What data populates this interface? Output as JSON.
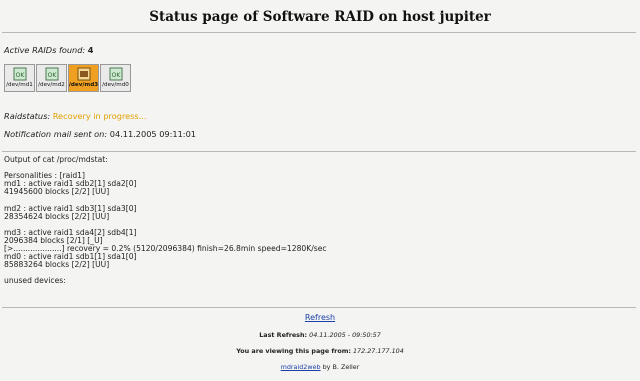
{
  "title": "Status page of Software RAID on host jupiter",
  "active_raids": {
    "label": "Active RAIDs found:",
    "value": "4"
  },
  "drives": [
    {
      "label": "/dev/md1",
      "icon": "disk-ok-icon",
      "active": false
    },
    {
      "label": "/dev/md2",
      "icon": "disk-ok-icon",
      "active": false
    },
    {
      "label": "/dev/md3",
      "icon": "disk-recovery-icon",
      "active": true
    },
    {
      "label": "/dev/md0",
      "icon": "disk-ok-icon",
      "active": false
    }
  ],
  "raid_status": {
    "label": "Raidstatus:",
    "value": "Recovery in progress..."
  },
  "notification": {
    "label": "Notification mail sent on:",
    "value": "04.11.2005 09:11:01"
  },
  "mdstat": {
    "heading": "Output of cat /proc/mdstat:",
    "lines": [
      "Personalities : [raid1]",
      "md1 : active raid1 sdb2[1] sda2[0]",
      "41945600 blocks [2/2] [UU]",
      "",
      "md2 : active raid1 sdb3[1] sda3[0]",
      "28354624 blocks [2/2] [UU]",
      "",
      "md3 : active raid1 sda4[2] sdb4[1]",
      "2096384 blocks [2/1] [_U]",
      "[>....................] recovery = 0.2% (5120/2096384) finish=26.8min speed=1280K/sec",
      "md0 : active raid1 sdb1[1] sda1[0]",
      "85883264 blocks [2/2] [UU]",
      "",
      "unused devices: "
    ]
  },
  "refresh": {
    "label": "Refresh"
  },
  "last_refresh": {
    "label": "Last Refresh:",
    "value": "04.11.2005 - 09:50:57"
  },
  "viewing_from": {
    "label": "You are viewing this page from:",
    "value": "172.27.177.104"
  },
  "footer": {
    "link": "mdraid2web",
    "by": "by B. Zeller"
  },
  "colors": {
    "status": "#e0a000",
    "link": "#1a3fa6",
    "active_drive": "#f0a020"
  }
}
